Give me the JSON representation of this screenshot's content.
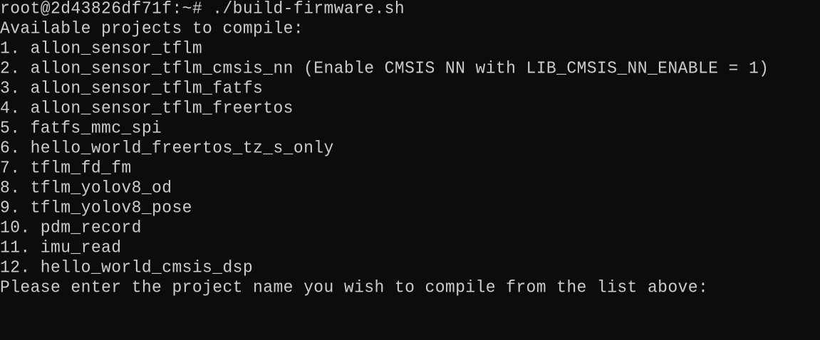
{
  "terminal": {
    "prompt_line": "root@2d43826df71f:~# ./build-firmware.sh",
    "header": "Available projects to compile:",
    "projects": [
      "1. allon_sensor_tflm",
      "2. allon_sensor_tflm_cmsis_nn (Enable CMSIS NN with LIB_CMSIS_NN_ENABLE = 1)",
      "3. allon_sensor_tflm_fatfs",
      "4. allon_sensor_tflm_freertos",
      "5. fatfs_mmc_spi",
      "6. hello_world_freertos_tz_s_only",
      "7. tflm_fd_fm",
      "8. tflm_yolov8_od",
      "9. tflm_yolov8_pose",
      "10. pdm_record",
      "11. imu_read",
      "12. hello_world_cmsis_dsp"
    ],
    "input_prompt": "Please enter the project name you wish to compile from the list above:"
  },
  "colors": {
    "background": "#0c0c0c",
    "foreground": "#cccccc"
  }
}
